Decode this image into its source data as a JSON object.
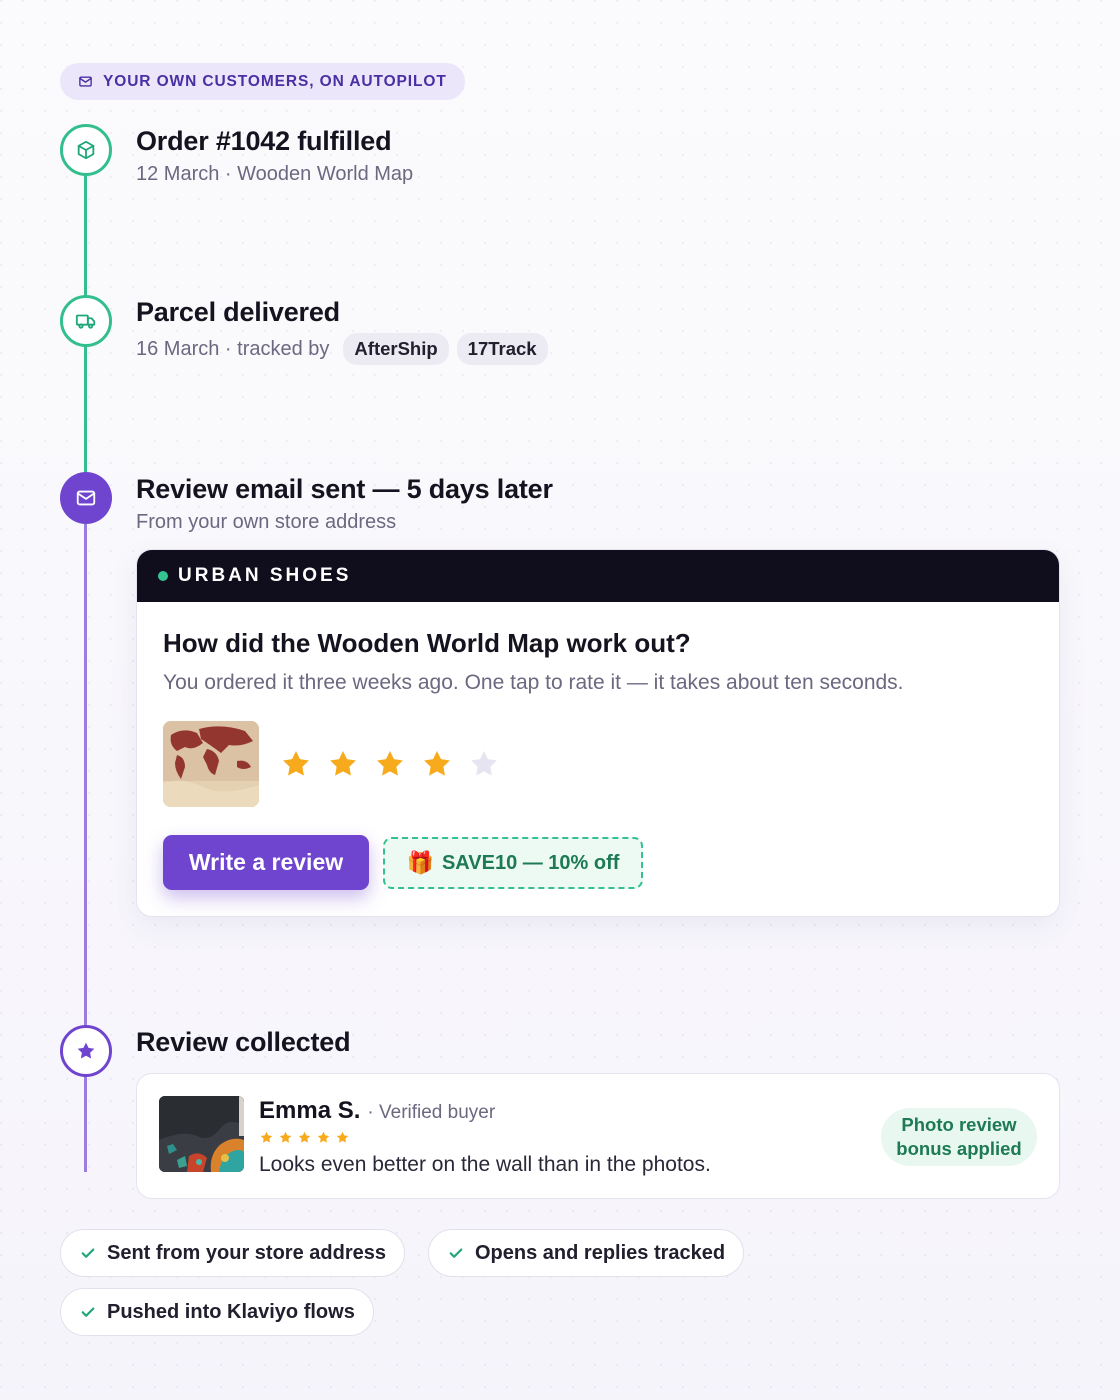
{
  "eyebrow": {
    "label": "YOUR OWN CUSTOMERS, ON AUTOPILOT",
    "icon": "mail-icon"
  },
  "timeline": {
    "order": {
      "title": "Order #1042 fulfilled",
      "subtitle": "12 March · Wooden World Map",
      "icon": "box-icon"
    },
    "delivered": {
      "title": "Parcel delivered",
      "subtitle": "16 March · tracked by",
      "trackers": [
        "AfterShip",
        "17Track"
      ],
      "icon": "truck-icon"
    },
    "email": {
      "title": "Review email sent — 5 days later",
      "subtitle": "From your own store address",
      "icon": "mail-icon"
    },
    "collected": {
      "title": "Review collected",
      "icon": "star-icon"
    }
  },
  "email_card": {
    "brand": "URBAN SHOES",
    "question": "How did the Wooden World Map work out?",
    "description": "You ordered it three weeks ago. One tap to rate it — it takes about ten seconds.",
    "rating": {
      "value": 4,
      "max": 5
    },
    "cta_label": "Write a review",
    "coupon_icon": "🎁",
    "coupon_label": "SAVE10 — 10% off"
  },
  "review": {
    "name": "Emma S.",
    "verified": "· Verified buyer",
    "stars": 5,
    "text": "Looks even better on the wall than in the photos.",
    "badge_line1": "Photo review",
    "badge_line2": "bonus applied"
  },
  "features": [
    "Sent from your store address",
    "Opens and replies tracked",
    "Pushed into Klaviyo flows"
  ],
  "colors": {
    "accent": "#6f45cf",
    "green": "#32be8d",
    "star": "#f6aa1c",
    "star_empty": "#e7e4f1",
    "dark": "#100e1d"
  }
}
